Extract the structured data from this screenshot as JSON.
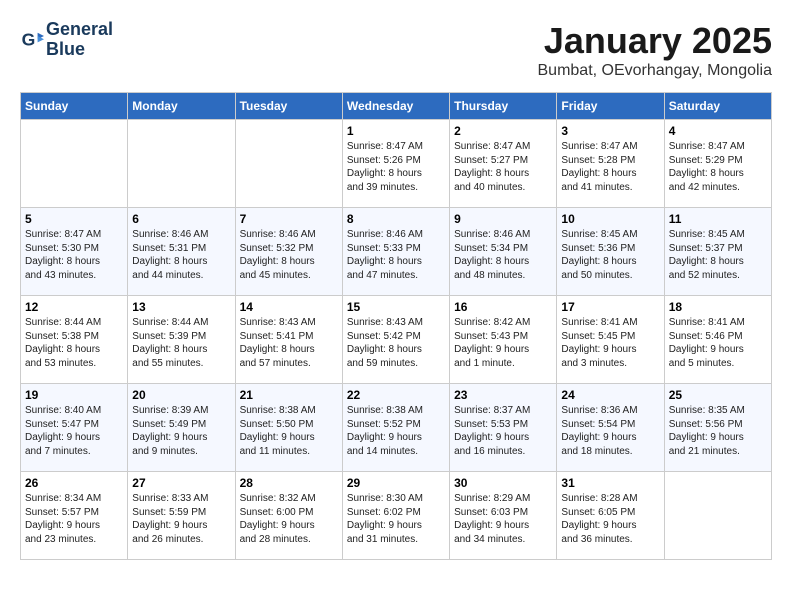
{
  "logo": {
    "name_line1": "General",
    "name_line2": "Blue"
  },
  "title": "January 2025",
  "subtitle": "Bumbat, OEvorhangay, Mongolia",
  "weekdays": [
    "Sunday",
    "Monday",
    "Tuesday",
    "Wednesday",
    "Thursday",
    "Friday",
    "Saturday"
  ],
  "weeks": [
    [
      {
        "day": "",
        "info": ""
      },
      {
        "day": "",
        "info": ""
      },
      {
        "day": "",
        "info": ""
      },
      {
        "day": "1",
        "info": "Sunrise: 8:47 AM\nSunset: 5:26 PM\nDaylight: 8 hours\nand 39 minutes."
      },
      {
        "day": "2",
        "info": "Sunrise: 8:47 AM\nSunset: 5:27 PM\nDaylight: 8 hours\nand 40 minutes."
      },
      {
        "day": "3",
        "info": "Sunrise: 8:47 AM\nSunset: 5:28 PM\nDaylight: 8 hours\nand 41 minutes."
      },
      {
        "day": "4",
        "info": "Sunrise: 8:47 AM\nSunset: 5:29 PM\nDaylight: 8 hours\nand 42 minutes."
      }
    ],
    [
      {
        "day": "5",
        "info": "Sunrise: 8:47 AM\nSunset: 5:30 PM\nDaylight: 8 hours\nand 43 minutes."
      },
      {
        "day": "6",
        "info": "Sunrise: 8:46 AM\nSunset: 5:31 PM\nDaylight: 8 hours\nand 44 minutes."
      },
      {
        "day": "7",
        "info": "Sunrise: 8:46 AM\nSunset: 5:32 PM\nDaylight: 8 hours\nand 45 minutes."
      },
      {
        "day": "8",
        "info": "Sunrise: 8:46 AM\nSunset: 5:33 PM\nDaylight: 8 hours\nand 47 minutes."
      },
      {
        "day": "9",
        "info": "Sunrise: 8:46 AM\nSunset: 5:34 PM\nDaylight: 8 hours\nand 48 minutes."
      },
      {
        "day": "10",
        "info": "Sunrise: 8:45 AM\nSunset: 5:36 PM\nDaylight: 8 hours\nand 50 minutes."
      },
      {
        "day": "11",
        "info": "Sunrise: 8:45 AM\nSunset: 5:37 PM\nDaylight: 8 hours\nand 52 minutes."
      }
    ],
    [
      {
        "day": "12",
        "info": "Sunrise: 8:44 AM\nSunset: 5:38 PM\nDaylight: 8 hours\nand 53 minutes."
      },
      {
        "day": "13",
        "info": "Sunrise: 8:44 AM\nSunset: 5:39 PM\nDaylight: 8 hours\nand 55 minutes."
      },
      {
        "day": "14",
        "info": "Sunrise: 8:43 AM\nSunset: 5:41 PM\nDaylight: 8 hours\nand 57 minutes."
      },
      {
        "day": "15",
        "info": "Sunrise: 8:43 AM\nSunset: 5:42 PM\nDaylight: 8 hours\nand 59 minutes."
      },
      {
        "day": "16",
        "info": "Sunrise: 8:42 AM\nSunset: 5:43 PM\nDaylight: 9 hours\nand 1 minute."
      },
      {
        "day": "17",
        "info": "Sunrise: 8:41 AM\nSunset: 5:45 PM\nDaylight: 9 hours\nand 3 minutes."
      },
      {
        "day": "18",
        "info": "Sunrise: 8:41 AM\nSunset: 5:46 PM\nDaylight: 9 hours\nand 5 minutes."
      }
    ],
    [
      {
        "day": "19",
        "info": "Sunrise: 8:40 AM\nSunset: 5:47 PM\nDaylight: 9 hours\nand 7 minutes."
      },
      {
        "day": "20",
        "info": "Sunrise: 8:39 AM\nSunset: 5:49 PM\nDaylight: 9 hours\nand 9 minutes."
      },
      {
        "day": "21",
        "info": "Sunrise: 8:38 AM\nSunset: 5:50 PM\nDaylight: 9 hours\nand 11 minutes."
      },
      {
        "day": "22",
        "info": "Sunrise: 8:38 AM\nSunset: 5:52 PM\nDaylight: 9 hours\nand 14 minutes."
      },
      {
        "day": "23",
        "info": "Sunrise: 8:37 AM\nSunset: 5:53 PM\nDaylight: 9 hours\nand 16 minutes."
      },
      {
        "day": "24",
        "info": "Sunrise: 8:36 AM\nSunset: 5:54 PM\nDaylight: 9 hours\nand 18 minutes."
      },
      {
        "day": "25",
        "info": "Sunrise: 8:35 AM\nSunset: 5:56 PM\nDaylight: 9 hours\nand 21 minutes."
      }
    ],
    [
      {
        "day": "26",
        "info": "Sunrise: 8:34 AM\nSunset: 5:57 PM\nDaylight: 9 hours\nand 23 minutes."
      },
      {
        "day": "27",
        "info": "Sunrise: 8:33 AM\nSunset: 5:59 PM\nDaylight: 9 hours\nand 26 minutes."
      },
      {
        "day": "28",
        "info": "Sunrise: 8:32 AM\nSunset: 6:00 PM\nDaylight: 9 hours\nand 28 minutes."
      },
      {
        "day": "29",
        "info": "Sunrise: 8:30 AM\nSunset: 6:02 PM\nDaylight: 9 hours\nand 31 minutes."
      },
      {
        "day": "30",
        "info": "Sunrise: 8:29 AM\nSunset: 6:03 PM\nDaylight: 9 hours\nand 34 minutes."
      },
      {
        "day": "31",
        "info": "Sunrise: 8:28 AM\nSunset: 6:05 PM\nDaylight: 9 hours\nand 36 minutes."
      },
      {
        "day": "",
        "info": ""
      }
    ]
  ]
}
